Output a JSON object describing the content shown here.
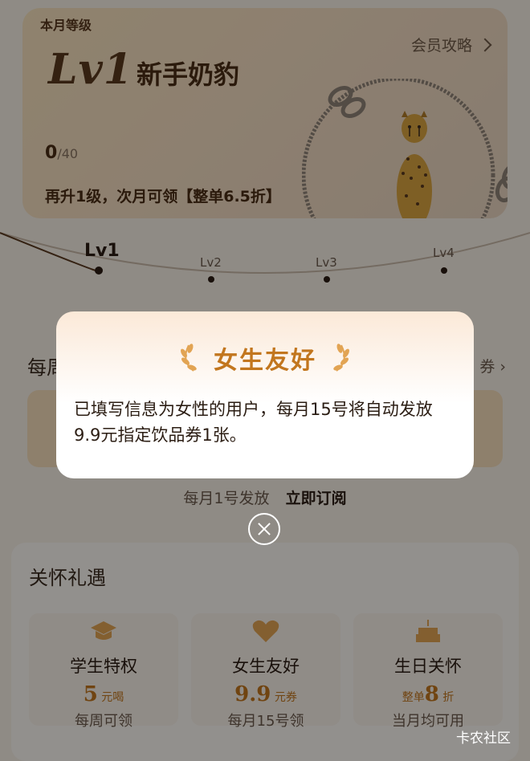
{
  "level": {
    "month_tag": "本月等级",
    "current_level": "Lv1",
    "level_name": "新手奶豹",
    "strategy_link": "会员攻略",
    "points": "0",
    "points_total": "/40",
    "upgrade_hint": "再升1级，次月可领【整单6.5折】"
  },
  "track": {
    "levels": [
      "Lv1",
      "Lv2",
      "Lv3",
      "Lv4"
    ]
  },
  "weekly": {
    "title": "每周",
    "more": "券",
    "note": "每月1号发放",
    "subscribe": "立即订阅"
  },
  "care": {
    "title": "关怀礼遇",
    "perks": [
      {
        "icon": "graduation-cap-icon",
        "name": "学生特权",
        "value": "5",
        "unit": "元喝",
        "prefix": "",
        "freq": "每周可领"
      },
      {
        "icon": "heart-icon",
        "name": "女生友好",
        "value": "9.9",
        "unit": "元券",
        "prefix": "",
        "freq": "每月15号领"
      },
      {
        "icon": "cake-icon",
        "name": "生日关怀",
        "value": "8",
        "unit": "折",
        "prefix": "整单",
        "freq": "当月均可用"
      }
    ]
  },
  "modal": {
    "title": "女生友好",
    "body": "已填写信息为女性的用户，每月15号将自动发放9.9元指定饮品券1张。"
  },
  "watermark": "卡农社区",
  "colors": {
    "accent": "#c2761e",
    "text_dark": "#2b1d13",
    "card_bg": "#f7e2bd"
  }
}
